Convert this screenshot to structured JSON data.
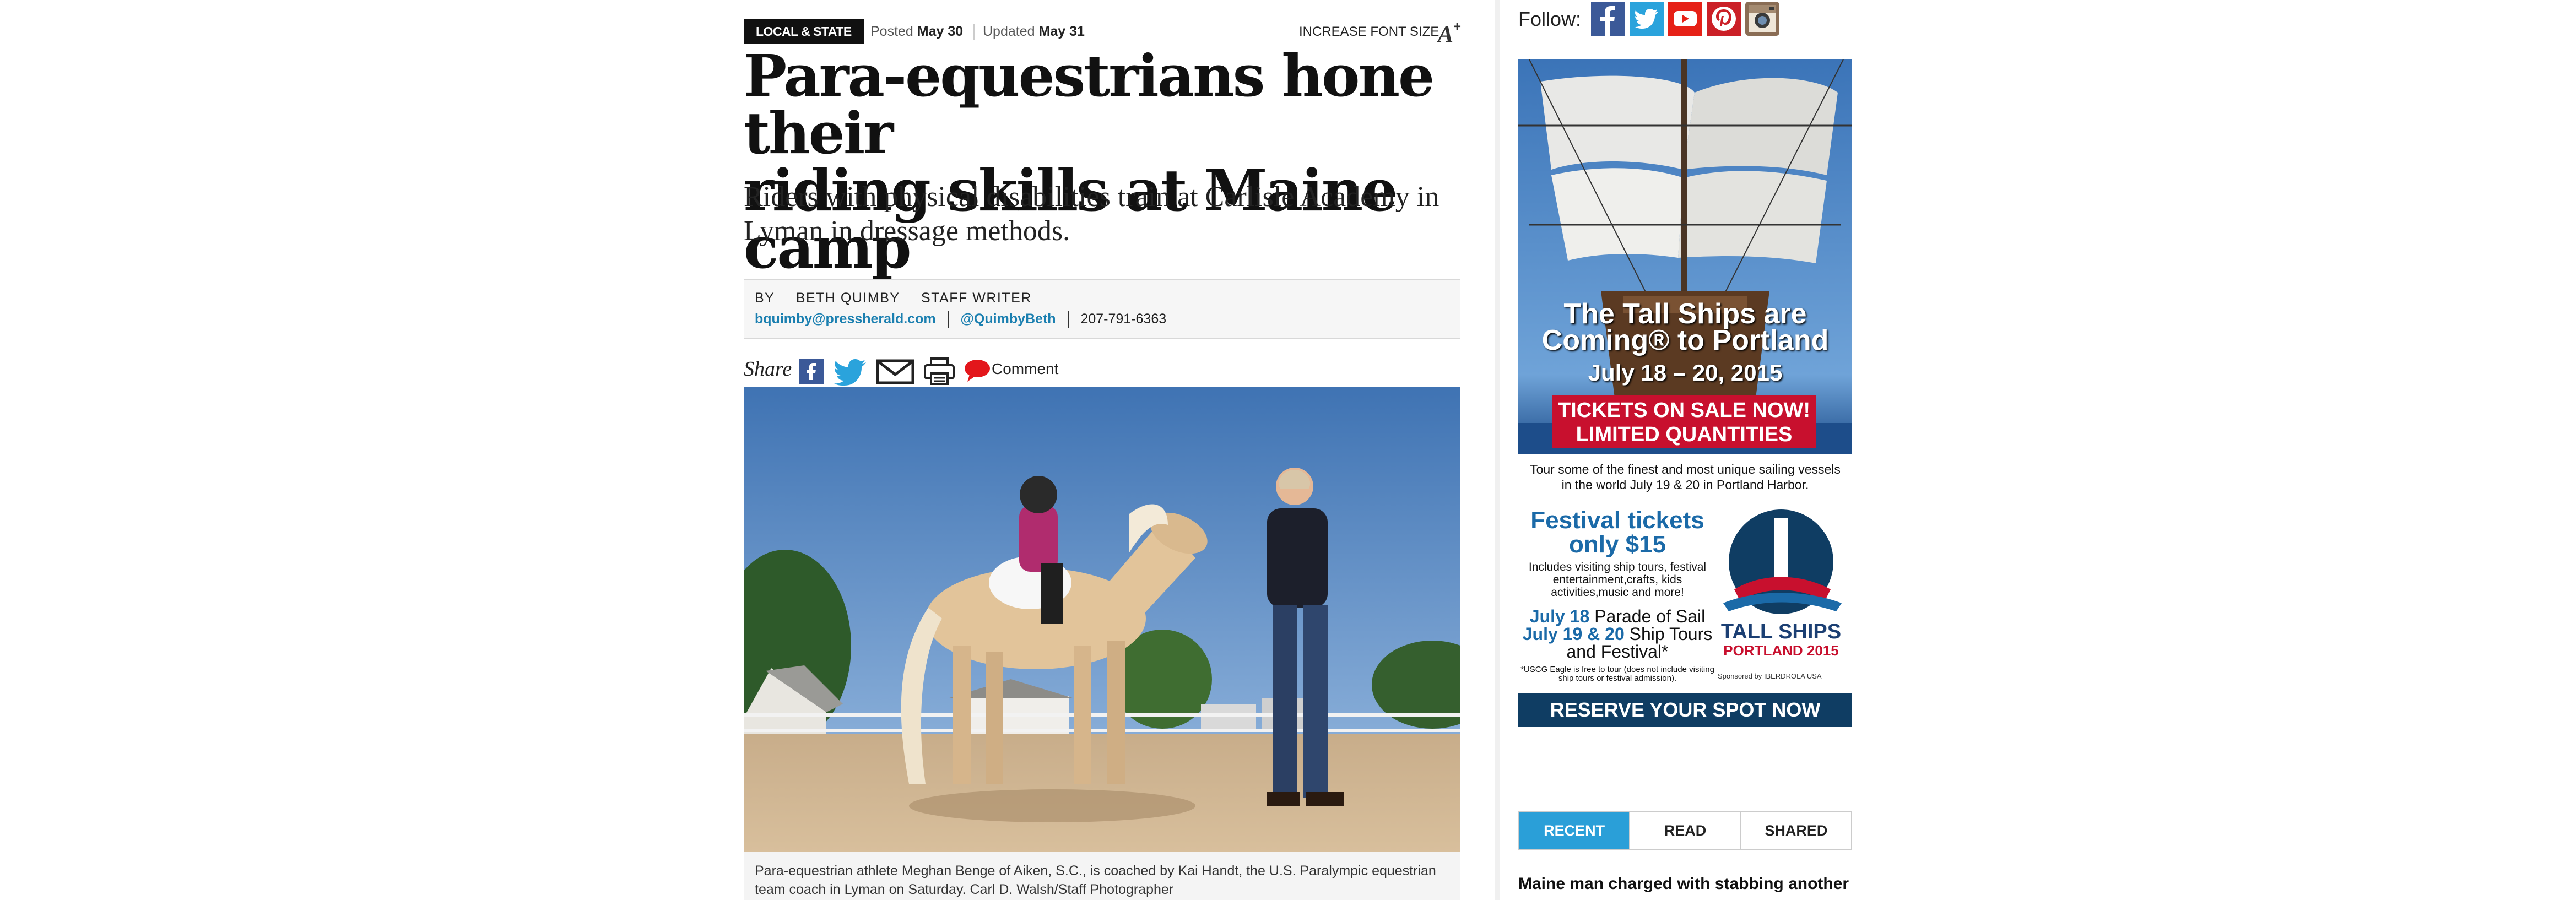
{
  "article": {
    "section": "LOCAL & STATE",
    "posted_label": "Posted",
    "posted_date": "May 30",
    "updated_label": "Updated",
    "updated_date": "May 31",
    "font_size_label": "INCREASE FONT SIZE",
    "font_size_icon": "A+",
    "headline_line1": "Para-equestrians hone their",
    "headline_line2": "riding skills at Maine camp",
    "subhead": "Riders with physical disabilities train at Carlisle Academy in Lyman in dressage methods.",
    "byline": {
      "by": "BY",
      "author": "BETH QUIMBY",
      "role": "STAFF WRITER",
      "email": "bquimby@pressherald.com",
      "twitter": "@QuimbyBeth",
      "phone": "207-791-6363"
    },
    "share": {
      "label": "Share",
      "icons": [
        "facebook-icon",
        "twitter-icon",
        "email-icon",
        "print-icon",
        "comment-icon"
      ],
      "comment_label": "Comment"
    },
    "caption": "Para-equestrian athlete Meghan Benge of Aiken, S.C., is coached by Kai Handt, the U.S. Paralympic equestrian team coach in Lyman on Saturday. Carl D. Walsh/Staff Photographer"
  },
  "sidebar": {
    "follow_label": "Follow:",
    "social": [
      {
        "name": "facebook",
        "glyph": "f",
        "color": "#3b5998"
      },
      {
        "name": "twitter",
        "glyph": "t",
        "color": "#1da1f2"
      },
      {
        "name": "youtube",
        "glyph": "▶",
        "color": "#e62117"
      },
      {
        "name": "pinterest",
        "glyph": "p",
        "color": "#cb2027"
      },
      {
        "name": "instagram",
        "glyph": "◎",
        "color": "#8a6d55"
      }
    ],
    "ad": {
      "title_line1": "The Tall Ships are",
      "title_line2": "Coming® to Portland",
      "dates": "July 18 – 20, 2015",
      "sale_line1": "TICKETS ON SALE NOW!",
      "sale_line2": "LIMITED QUANTITIES",
      "tour": "Tour some of the finest and most unique sailing vessels in the world July 19 & 20 in Portland Harbor.",
      "festival_line1": "Festival tickets",
      "festival_line2": "only $15",
      "includes": "Includes visiting ship tours, festival entertainment,crafts, kids activities,music and more!",
      "parade_date": "July 18",
      "parade_text": "Parade of Sail",
      "tours_date": "July 19 & 20",
      "tours_text": "Ship Tours",
      "festival_text": "and Festival*",
      "fine_print": "*USCG Eagle is free to tour (does not include visiting ship tours or festival admission).",
      "logo_text": "TALL SHIPS",
      "logo_sub": "PORTLAND 2015",
      "sponsor": "Sponsored by IBERDROLA USA",
      "reserve": "RESERVE YOUR SPOT NOW"
    },
    "tabs": [
      {
        "label": "RECENT",
        "active": true
      },
      {
        "label": "READ",
        "active": false
      },
      {
        "label": "SHARED",
        "active": false
      }
    ],
    "story_headline": "Maine man charged with stabbing another"
  }
}
